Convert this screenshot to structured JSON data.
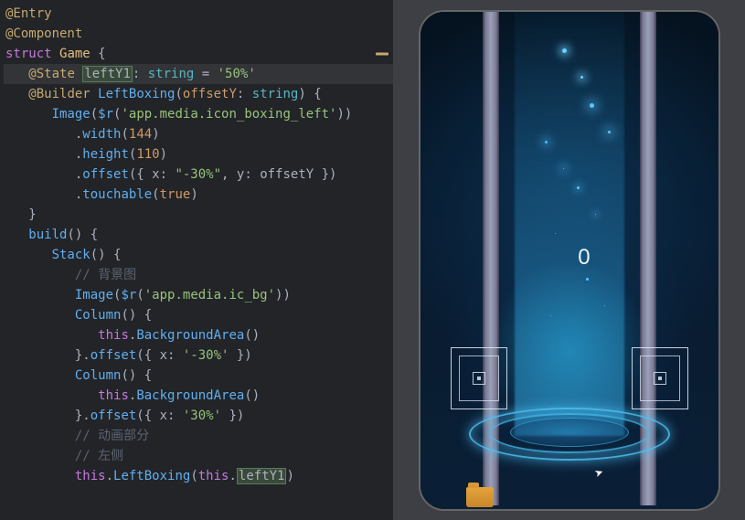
{
  "code": {
    "l1": "@Entry",
    "l2": "@Component",
    "l3_kw": "struct",
    "l3_name": "Game",
    "l4_dec": "@State",
    "l4_var": "leftY1",
    "l4_type": "string",
    "l4_val": "'50%'",
    "l5_dec": "@Builder",
    "l5_fn": "LeftBoxing",
    "l5_param": "offsetY",
    "l5_ptype": "string",
    "l6_fn": "Image",
    "l6_rfn": "$r",
    "l6_arg": "'app.media.icon_boxing_left'",
    "l7_m": "width",
    "l7_v": "144",
    "l8_m": "height",
    "l8_v": "110",
    "l9_m": "offset",
    "l9_x": "\"-30%\"",
    "l9_y": "offsetY",
    "l10_m": "touchable",
    "l10_v": "true",
    "l12_fn": "build",
    "l13_fn": "Stack",
    "l14_c": "// 背景图",
    "l15_fn": "Image",
    "l15_rfn": "$r",
    "l15_arg": "'app.media.ic_bg'",
    "l16_fn": "Column",
    "l17_this": "this",
    "l17_m": "BackgroundArea",
    "l18_m": "offset",
    "l18_x": "'-30%'",
    "l19_fn": "Column",
    "l20_this": "this",
    "l20_m": "BackgroundArea",
    "l21_m": "offset",
    "l21_x": "'30%'",
    "l22_c": "// 动画部分",
    "l23_c": "// 左侧",
    "l24_this": "this",
    "l24_m": "LeftBoxing",
    "l24_this2": "this",
    "l24_p": "leftY1"
  },
  "preview": {
    "score": "0"
  }
}
